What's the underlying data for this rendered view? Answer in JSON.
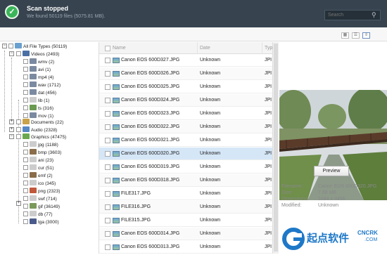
{
  "header": {
    "title": "Scan stopped",
    "subtitle": "We found 50119 files (5075.81 MB).",
    "search_placeholder": "Search"
  },
  "tree": [
    {
      "label": "All File Types (50119)",
      "icon": "drive-icon",
      "color": "#6aa0cf"
    },
    {
      "label": "Videos (2493)",
      "icon": "film-folder-icon",
      "color": "#4a6fa5"
    },
    {
      "label": "wmv (2)",
      "icon": "video-file-icon",
      "color": "#7a8aa0"
    },
    {
      "label": "avi (1)",
      "icon": "video-file-icon",
      "color": "#7a8aa0"
    },
    {
      "label": "mp4 (4)",
      "icon": "video-file-icon",
      "color": "#7a8aa0"
    },
    {
      "label": "wav (1712)",
      "icon": "audio-file-icon",
      "color": "#7a8aa0"
    },
    {
      "label": "dat (456)",
      "icon": "video-file-icon",
      "color": "#7a8aa0"
    },
    {
      "label": "lib (1)",
      "icon": "file-icon",
      "color": "#cccccc"
    },
    {
      "label": "ts (316)",
      "icon": "video-file-icon",
      "color": "#6a9a50"
    },
    {
      "label": "mov (1)",
      "icon": "video-file-icon",
      "color": "#7a8aa0"
    },
    {
      "label": "Documents (22)",
      "icon": "document-folder-icon",
      "color": "#c9a24a"
    },
    {
      "label": "Audio (2328)",
      "icon": "music-folder-icon",
      "color": "#5588c4"
    },
    {
      "label": "Graphics (47475)",
      "icon": "picture-folder-icon",
      "color": "#6aa84f"
    },
    {
      "label": "jpg (1188)",
      "icon": "image-file-icon",
      "color": "#cccccc"
    },
    {
      "label": "bmp (3603)",
      "icon": "image-file-icon",
      "color": "#8a6d4a"
    },
    {
      "label": "ani (23)",
      "icon": "file-icon",
      "color": "#cccccc"
    },
    {
      "label": "cur (51)",
      "icon": "file-icon",
      "color": "#cccccc"
    },
    {
      "label": "emf (2)",
      "icon": "image-file-icon",
      "color": "#8a6d4a"
    },
    {
      "label": "ico (345)",
      "icon": "file-icon",
      "color": "#cccccc"
    },
    {
      "label": "png (2323)",
      "icon": "image-file-icon",
      "color": "#c0583a"
    },
    {
      "label": "swf (714)",
      "icon": "file-icon",
      "color": "#cccccc"
    },
    {
      "label": "gif (36149)",
      "icon": "image-file-icon",
      "color": "#7a9a5a"
    },
    {
      "label": "db (77)",
      "icon": "file-icon",
      "color": "#cccccc"
    },
    {
      "label": "tga (3000)",
      "icon": "image-file-icon",
      "color": "#4a5a8a"
    }
  ],
  "list": {
    "headers": {
      "name": "Name",
      "date": "Date",
      "type": "Typ"
    },
    "rows": [
      {
        "name": "Canon EOS 600D327.JPG",
        "date": "Unknown",
        "type": "JPI"
      },
      {
        "name": "Canon EOS 600D326.JPG",
        "date": "Unknown",
        "type": "JPI"
      },
      {
        "name": "Canon EOS 600D325.JPG",
        "date": "Unknown",
        "type": "JPI"
      },
      {
        "name": "Canon EOS 600D324.JPG",
        "date": "Unknown",
        "type": "JPI"
      },
      {
        "name": "Canon EOS 600D323.JPG",
        "date": "Unknown",
        "type": "JPI"
      },
      {
        "name": "Canon EOS 600D322.JPG",
        "date": "Unknown",
        "type": "JPI"
      },
      {
        "name": "Canon EOS 600D321.JPG",
        "date": "Unknown",
        "type": "JPI"
      },
      {
        "name": "Canon EOS 600D320.JPG",
        "date": "Unknown",
        "type": "JPI"
      },
      {
        "name": "Canon EOS 600D319.JPG",
        "date": "Unknown",
        "type": "JPI"
      },
      {
        "name": "Canon EOS 600D318.JPG",
        "date": "Unknown",
        "type": "JPI"
      },
      {
        "name": "FILE317.JPG",
        "date": "Unknown",
        "type": "JPI"
      },
      {
        "name": "FILE316.JPG",
        "date": "Unknown",
        "type": "JPI"
      },
      {
        "name": "FILE315.JPG",
        "date": "Unknown",
        "type": "JPI"
      },
      {
        "name": "Canon EOS 600D314.JPG",
        "date": "Unknown",
        "type": "JPI"
      },
      {
        "name": "Canon EOS 600D313.JPG",
        "date": "Unknown",
        "type": "JPI"
      }
    ]
  },
  "preview": {
    "button": "Preview",
    "filename_label": "Filename:",
    "filename": "Canon EOS 600D320.JPG",
    "size_label": "Size:",
    "size": "7.88 MB",
    "dimensions_label": "Dimensions:",
    "dimensions": "5184 x 3456",
    "modified_label": "Modified:",
    "modified": "Unknown"
  },
  "watermark": {
    "brand": "起点软件",
    "domain": "CNCRK",
    "tld": ".COM"
  },
  "colors": {
    "header_bg": "#37434f",
    "success": "#3bb55a",
    "selection": "#d5e6f7"
  }
}
